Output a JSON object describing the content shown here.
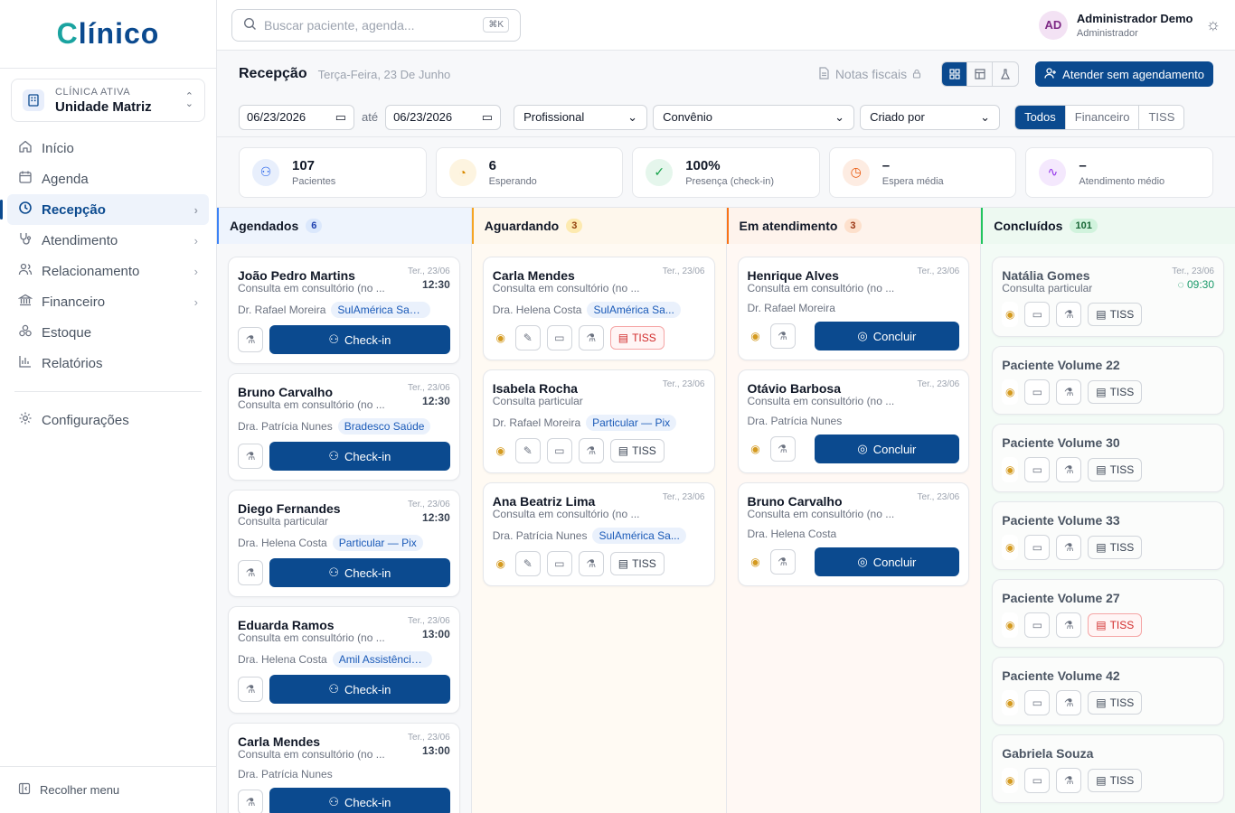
{
  "brand": {
    "logo_first": "C",
    "logo_rest": "línico"
  },
  "clinic": {
    "label": "CLÍNICA ATIVA",
    "name": "Unidade Matriz"
  },
  "nav": {
    "items": [
      {
        "label": "Início"
      },
      {
        "label": "Agenda"
      },
      {
        "label": "Recepção",
        "active": true
      },
      {
        "label": "Atendimento"
      },
      {
        "label": "Relacionamento"
      },
      {
        "label": "Financeiro"
      },
      {
        "label": "Estoque"
      },
      {
        "label": "Relatórios"
      }
    ],
    "settings": "Configurações",
    "collapse": "Recolher menu"
  },
  "search": {
    "placeholder": "Buscar paciente, agenda...",
    "shortcut": "⌘K"
  },
  "user": {
    "initials": "AD",
    "name": "Administrador Demo",
    "role": "Administrador"
  },
  "page": {
    "title": "Recepção",
    "date": "Terça-Feira, 23 De Junho",
    "notas": "Notas fiscais",
    "cta": "Atender sem agendamento"
  },
  "filters": {
    "from": "06/23/2026",
    "until_label": "até",
    "to": "06/23/2026",
    "profissional": "Profissional",
    "convenio": "Convênio",
    "criado_por": "Criado por",
    "segments": [
      "Todos",
      "Financeiro",
      "TISS"
    ]
  },
  "stats": [
    {
      "value": "107",
      "label": "Pacientes",
      "color": "#2563eb",
      "bg": "#e8effc"
    },
    {
      "value": "6",
      "label": "Esperando",
      "color": "#d98a00",
      "bg": "#fdf4e0"
    },
    {
      "value": "100%",
      "label": "Presença (check-in)",
      "color": "#16a34a",
      "bg": "#e5f6ec"
    },
    {
      "value": "–",
      "label": "Espera média",
      "color": "#ea580c",
      "bg": "#fdece2"
    },
    {
      "value": "–",
      "label": "Atendimento médio",
      "color": "#9333ea",
      "bg": "#f4e8fd"
    }
  ],
  "columns": {
    "agendados": {
      "title": "Agendados",
      "count": "6",
      "color": "#3b82f6",
      "bg": "#eef4fd",
      "badge_bg": "#dbe8fc",
      "badge_fg": "#1e40af",
      "body_bg": "#f7f8fa"
    },
    "aguardando": {
      "title": "Aguardando",
      "count": "3",
      "color": "#f5a524",
      "bg": "#fef7ec",
      "badge_bg": "#fdeab0",
      "badge_fg": "#92400e",
      "body_bg": "#fffaf3"
    },
    "atendimento": {
      "title": "Em atendimento",
      "count": "3",
      "color": "#f97316",
      "bg": "#fef3ec",
      "badge_bg": "#fde0cc",
      "badge_fg": "#9a3412",
      "body_bg": "#fff8f4"
    },
    "concluidos": {
      "title": "Concluídos",
      "count": "101",
      "color": "#22c55e",
      "bg": "#edf9f1",
      "badge_bg": "#d1f3dd",
      "badge_fg": "#166534",
      "body_bg": "#f3fbf6"
    }
  },
  "cards": {
    "agendados": [
      {
        "name": "João Pedro Martins",
        "date": "Ter., 23/06",
        "time": "12:30",
        "proc": "Consulta em consultório (no ...",
        "doc": "Dr. Rafael Moreira",
        "tag": "SulAmérica Saúde",
        "action": "Check-in"
      },
      {
        "name": "Bruno Carvalho",
        "date": "Ter., 23/06",
        "time": "12:30",
        "proc": "Consulta em consultório (no ...",
        "doc": "Dra. Patrícia Nunes",
        "tag": "Bradesco Saúde",
        "action": "Check-in"
      },
      {
        "name": "Diego Fernandes",
        "date": "Ter., 23/06",
        "time": "12:30",
        "proc": "Consulta particular",
        "doc": "Dra. Helena Costa",
        "tag": "Particular — Pix",
        "action": "Check-in"
      },
      {
        "name": "Eduarda Ramos",
        "date": "Ter., 23/06",
        "time": "13:00",
        "proc": "Consulta em consultório (no ...",
        "doc": "Dra. Helena Costa",
        "tag": "Amil Assistência...",
        "action": "Check-in"
      },
      {
        "name": "Carla Mendes",
        "date": "Ter., 23/06",
        "time": "13:00",
        "proc": "Consulta em consultório (no ...",
        "doc": "Dra. Patrícia Nunes",
        "tag": "",
        "action": "Check-in"
      }
    ],
    "aguardando": [
      {
        "name": "Carla Mendes",
        "date": "Ter., 23/06",
        "proc": "Consulta em consultório (no ...",
        "doc": "Dra. Helena Costa",
        "tag": "SulAmérica Sa...",
        "tiss": "TISS",
        "tiss_red": true
      },
      {
        "name": "Isabela Rocha",
        "date": "Ter., 23/06",
        "proc": "Consulta particular",
        "doc": "Dr. Rafael Moreira",
        "tag": "Particular — Pix",
        "tiss": "TISS",
        "tiss_red": false
      },
      {
        "name": "Ana Beatriz Lima",
        "date": "Ter., 23/06",
        "proc": "Consulta em consultório (no ...",
        "doc": "Dra. Patrícia Nunes",
        "tag": "SulAmérica Sa...",
        "tiss": "TISS",
        "tiss_red": false
      }
    ],
    "atendimento": [
      {
        "name": "Henrique Alves",
        "date": "Ter., 23/06",
        "proc": "Consulta em consultório (no ...",
        "doc": "Dr. Rafael Moreira",
        "action": "Concluir"
      },
      {
        "name": "Otávio Barbosa",
        "date": "Ter., 23/06",
        "proc": "Consulta em consultório (no ...",
        "doc": "Dra. Patrícia Nunes",
        "action": "Concluir"
      },
      {
        "name": "Bruno Carvalho",
        "date": "Ter., 23/06",
        "proc": "Consulta em consultório (no ...",
        "doc": "Dra. Helena Costa",
        "action": "Concluir"
      }
    ],
    "concluidos": [
      {
        "name": "Natália Gomes",
        "date": "Ter., 23/06",
        "time": "09:30",
        "proc": "Consulta particular",
        "tiss": "TISS",
        "tiss_red": false
      },
      {
        "name": "Paciente Volume 22",
        "tiss": "TISS",
        "tiss_red": false
      },
      {
        "name": "Paciente Volume 30",
        "tiss": "TISS",
        "tiss_red": false
      },
      {
        "name": "Paciente Volume 33",
        "tiss": "TISS",
        "tiss_red": false
      },
      {
        "name": "Paciente Volume 27",
        "tiss": "TISS",
        "tiss_red": true
      },
      {
        "name": "Paciente Volume 42",
        "tiss": "TISS",
        "tiss_red": false
      },
      {
        "name": "Gabriela Souza",
        "tiss": "TISS",
        "tiss_red": false
      }
    ]
  }
}
